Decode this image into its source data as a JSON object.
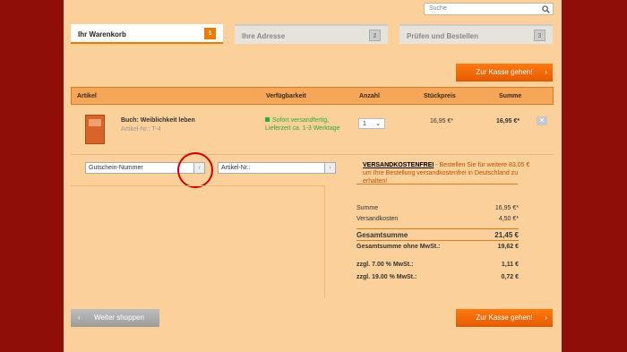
{
  "search": {
    "placeholder": "Suche"
  },
  "steps": [
    {
      "label": "Ihr Warenkorb",
      "num": "1"
    },
    {
      "label": "Ihre Adresse",
      "num": "2"
    },
    {
      "label": "Prüfen und Bestellen",
      "num": "3"
    }
  ],
  "checkout_label": "Zur Kasse gehen!",
  "table": {
    "headers": [
      "Artikel",
      "Verfügbarkeit",
      "Anzahl",
      "Stückpreis",
      "Summe"
    ],
    "row": {
      "title": "Buch: Weiblichkeit leben",
      "article_no": "Artikel-Nr.: T-4",
      "availability_1": "Sofort versandfertig,",
      "availability_2": "Lieferzeit ca. 1-3 Werktage",
      "qty": "1",
      "unit_price": "16,95 €*",
      "sum": "16,95 €*"
    }
  },
  "coupon": {
    "value": "Gutschein-Nummer"
  },
  "article_input": {
    "value": "Artikel-Nr.:"
  },
  "shipping_info": {
    "highlight": "VERSANDKOSTENFREI",
    "text": " - Bestellen Sie für weitere 83,05 € um Ihre Bestellung versandkostenfrei in Deutschland zu erhalten!"
  },
  "summary": {
    "sum_label": "Summe",
    "sum_value": "16,95 €*",
    "ship_label": "Versandkosten",
    "ship_value": "4,50 €*",
    "total_label": "Gesamtsumme",
    "total_value": "21,45 €",
    "net_label": "Gesamtsumme ohne MwSt.:",
    "net_value": "19,62 €",
    "vat7_label": "zzgl. 7.00 % MwSt.:",
    "vat7_value": "1,11 €",
    "vat19_label": "zzgl. 19.00 % MwSt.:",
    "vat19_value": "0,72 €"
  },
  "continue_label": "Weiter shoppen"
}
